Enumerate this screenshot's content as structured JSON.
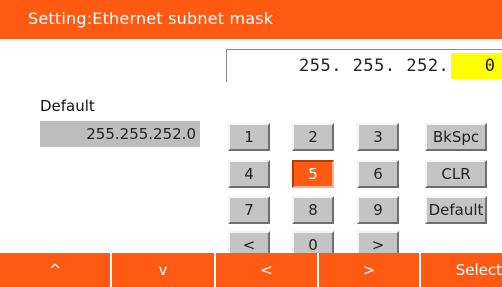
{
  "title": "Setting:Ethernet subnet mask",
  "entry": {
    "value_prefix": "255. 255. 252.",
    "cursor_value": "0"
  },
  "default": {
    "label": "Default",
    "value": "255.255.252.0"
  },
  "keypad": {
    "k1": "1",
    "k2": "2",
    "k3": "3",
    "k4": "4",
    "k5": "5",
    "k6": "6",
    "k7": "7",
    "k8": "8",
    "k9": "9",
    "left": "<",
    "k0": "0",
    "right": ">",
    "bkspc": "BkSpc",
    "clr": "CLR",
    "default": "Default",
    "active_key": "5"
  },
  "softkeys": {
    "up": "^",
    "down": "v",
    "left": "<",
    "right": ">",
    "select": "Select"
  },
  "colors": {
    "accent": "#ff5a14",
    "cursor_highlight": "#ffff00",
    "key_face": "#c4c4c4"
  }
}
